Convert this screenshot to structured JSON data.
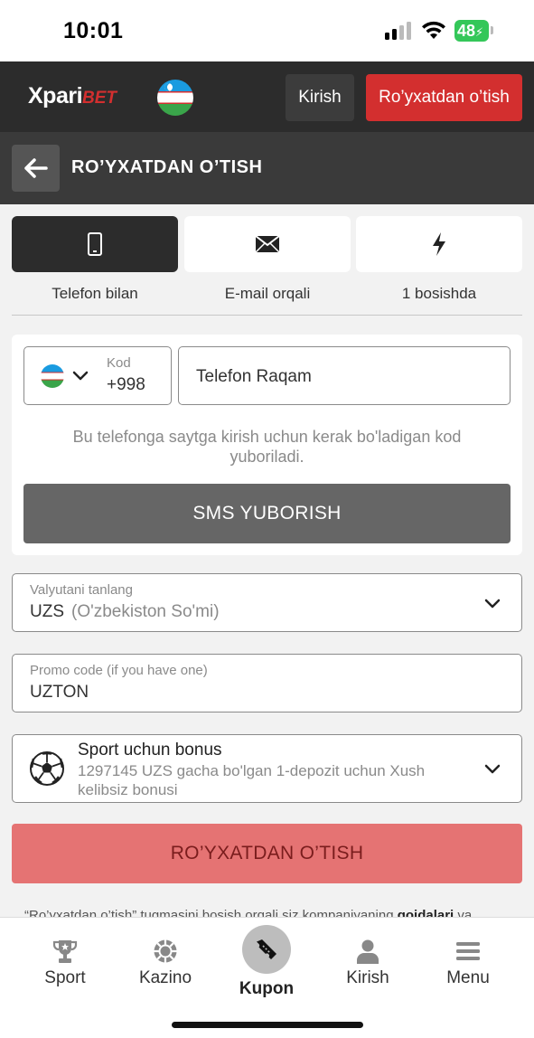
{
  "status": {
    "time": "10:01",
    "battery": "48"
  },
  "header": {
    "logo_main": "Xpari",
    "logo_accent": "BET",
    "login_label": "Kirish",
    "register_label": "Ro’yxatdan o’tish"
  },
  "page": {
    "title": "RO’YXATDAN O’TISH"
  },
  "tabs": [
    {
      "label": "Telefon bilan",
      "icon": "phone-icon",
      "active": true
    },
    {
      "label": "E-mail orqali",
      "icon": "envelope-icon",
      "active": false
    },
    {
      "label": "1 bosishda",
      "icon": "lightning-icon",
      "active": false
    }
  ],
  "phone": {
    "code_label": "Kod",
    "code_value": "+998",
    "placeholder": "Telefon Raqam",
    "hint": "Bu telefonga saytga kirish uchun kerak bo'ladigan kod yuboriladi.",
    "sms_button": "SMS YUBORISH"
  },
  "currency": {
    "label": "Valyutani tanlang",
    "code": "UZS",
    "name": "(O'zbekiston So'mi)"
  },
  "promo": {
    "label": "Promo code (if you have one)",
    "value": "UZTON"
  },
  "bonus": {
    "title": "Sport uchun bonus",
    "description": "1297145 UZS gacha bo'lgan 1-depozit uchun Xush kelibsiz bonusi"
  },
  "submit_label": "RO’YXATDAN O’TISH",
  "terms": {
    "prefix": "“Ro’yxatdan o’tish” tugmasini bosish orqali siz kompaniyaning ",
    "link": "qoidalari",
    "suffix": " va"
  },
  "nav": [
    {
      "label": "Sport",
      "icon": "trophy-icon"
    },
    {
      "label": "Kazino",
      "icon": "casino-chip-icon"
    },
    {
      "label": "Kupon",
      "icon": "ticket-icon"
    },
    {
      "label": "Kirish",
      "icon": "user-icon"
    },
    {
      "label": "Menu",
      "icon": "hamburger-icon"
    }
  ],
  "colors": {
    "brand_red": "#d32f2f",
    "header_dark": "#2c2c2c",
    "submit_disabled": "#e57373",
    "sms_button": "#666666"
  }
}
